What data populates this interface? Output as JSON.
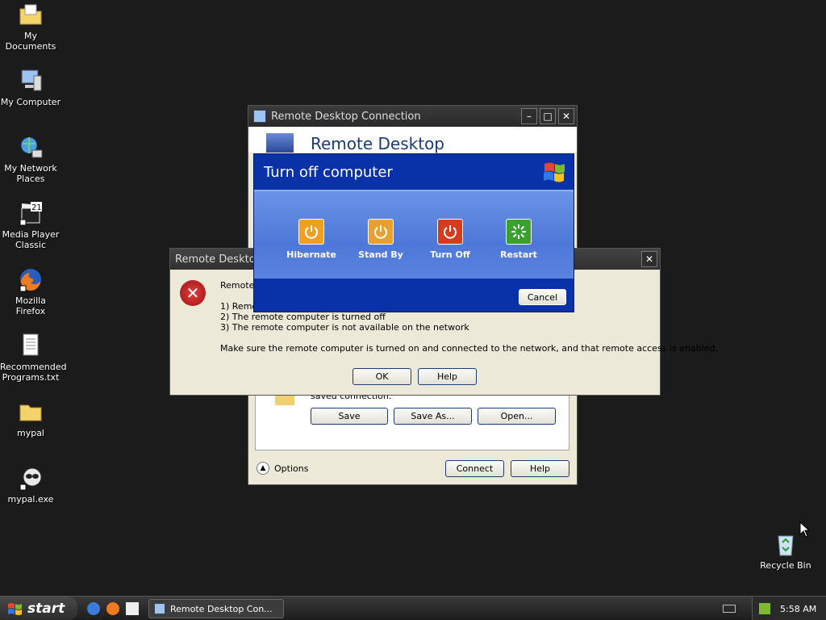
{
  "desktop": {
    "icons": [
      {
        "label": "My Documents"
      },
      {
        "label": "My Computer"
      },
      {
        "label": "My Network Places"
      },
      {
        "label": "Media Player Classic"
      },
      {
        "label": "Mozilla Firefox"
      },
      {
        "label": "Recommended Programs.txt"
      },
      {
        "label": "mypal"
      },
      {
        "label": "mypal.exe"
      },
      {
        "label": "Recycle Bin"
      }
    ]
  },
  "rdc_window": {
    "title": "Remote Desktop Connection",
    "banner": "Remote Desktop",
    "saved_text": "saved connection.",
    "save_label": "Save",
    "save_as_label": "Save As...",
    "open_label": "Open...",
    "options_label": "Options",
    "connect_label": "Connect",
    "help_label": "Help"
  },
  "error_dialog": {
    "title": "Remote Desktop",
    "intro": "Remote",
    "reason1": "1) Remo",
    "reason2": "2) The remote computer is turned off",
    "reason3": "3) The remote computer is not available on the network",
    "advice": "Make sure the remote computer is turned on and connected to the network, and that remote access is enabled.",
    "ok_label": "OK",
    "help_label": "Help"
  },
  "turnoff_dialog": {
    "title": "Turn off computer",
    "options": [
      {
        "label": "Hibernate",
        "color": "#f0a020"
      },
      {
        "label": "Stand By",
        "color": "#e8a030"
      },
      {
        "label": "Turn Off",
        "color": "#d83a20"
      },
      {
        "label": "Restart",
        "color": "#3aa030"
      }
    ],
    "cancel_label": "Cancel"
  },
  "taskbar": {
    "start_label": "start",
    "task_label": "Remote Desktop Con...",
    "clock": "5:58 AM"
  }
}
